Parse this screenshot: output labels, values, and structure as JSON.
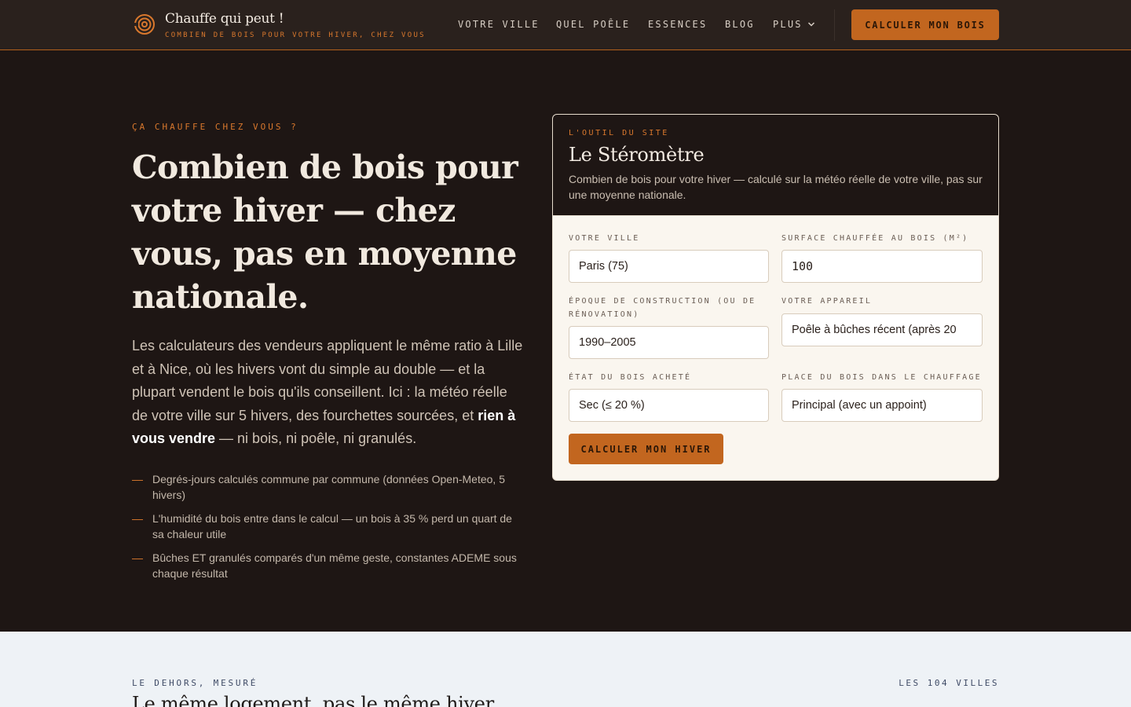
{
  "header": {
    "brand_title": "Chauffe qui peut !",
    "brand_subtitle": "COMBIEN DE BOIS POUR VOTRE HIVER, CHEZ VOUS",
    "nav": [
      "VOTRE VILLE",
      "QUEL POÊLE",
      "ESSENCES",
      "BLOG",
      "PLUS"
    ],
    "cta_label": "CALCULER MON BOIS"
  },
  "hero": {
    "eyebrow": "ÇA CHAUFFE CHEZ VOUS ?",
    "title": "Combien de bois pour votre hiver — chez vous, pas en moyenne nationale.",
    "text_before": "Les calculateurs des vendeurs appliquent le même ratio à Lille et à Nice, où les hivers vont du simple au double — et la plupart vendent le bois qu'ils conseillent. Ici : la météo réelle de votre ville sur 5 hivers, des fourchettes sourcées, et ",
    "text_strong": "rien à vous vendre",
    "text_after": " — ni bois, ni poêle, ni granulés.",
    "bullet_marker": "—",
    "bullets": [
      "Degrés-jours calculés commune par commune (données Open-Meteo, 5 hivers)",
      "L'humidité du bois entre dans le calcul — un bois à 35 % perd un quart de sa chaleur utile",
      "Bûches ET granulés comparés d'un même geste, constantes ADEME sous chaque résultat"
    ]
  },
  "tool": {
    "eyebrow": "L'OUTIL DU SITE",
    "title": "Le Stéromètre",
    "description": "Combien de bois pour votre hiver — calculé sur la météo réelle de votre ville, pas sur une moyenne nationale.",
    "fields": {
      "city": {
        "label": "VOTRE VILLE",
        "value": "Paris (75)"
      },
      "surface": {
        "label": "SURFACE CHAUFFÉE AU BOIS (M²)",
        "value": "100"
      },
      "epoch": {
        "label": "ÉPOQUE DE CONSTRUCTION (OU DE RÉNOVATION)",
        "value": "1990–2005"
      },
      "device": {
        "label": "VOTRE APPAREIL",
        "value": "Poêle à bûches récent (après 20"
      },
      "wood": {
        "label": "ÉTAT DU BOIS ACHETÉ",
        "value": "Sec (≤ 20 %)"
      },
      "role": {
        "label": "PLACE DU BOIS DANS LE CHAUFFAGE",
        "value": "Principal (avec un appoint)"
      }
    },
    "submit_label": "CALCULER MON HIVER"
  },
  "section2": {
    "eyebrow": "LE DEHORS, MESURÉ",
    "link": "LES 104 VILLES",
    "title": "Le même logement, pas le même hiver"
  },
  "colors": {
    "accent": "#c2661f",
    "accent_text": "#d9782d",
    "background": "#1e1614",
    "header_bg": "#2a211d",
    "card_bg": "#faf6ef",
    "band_bg": "#eef2f6"
  }
}
